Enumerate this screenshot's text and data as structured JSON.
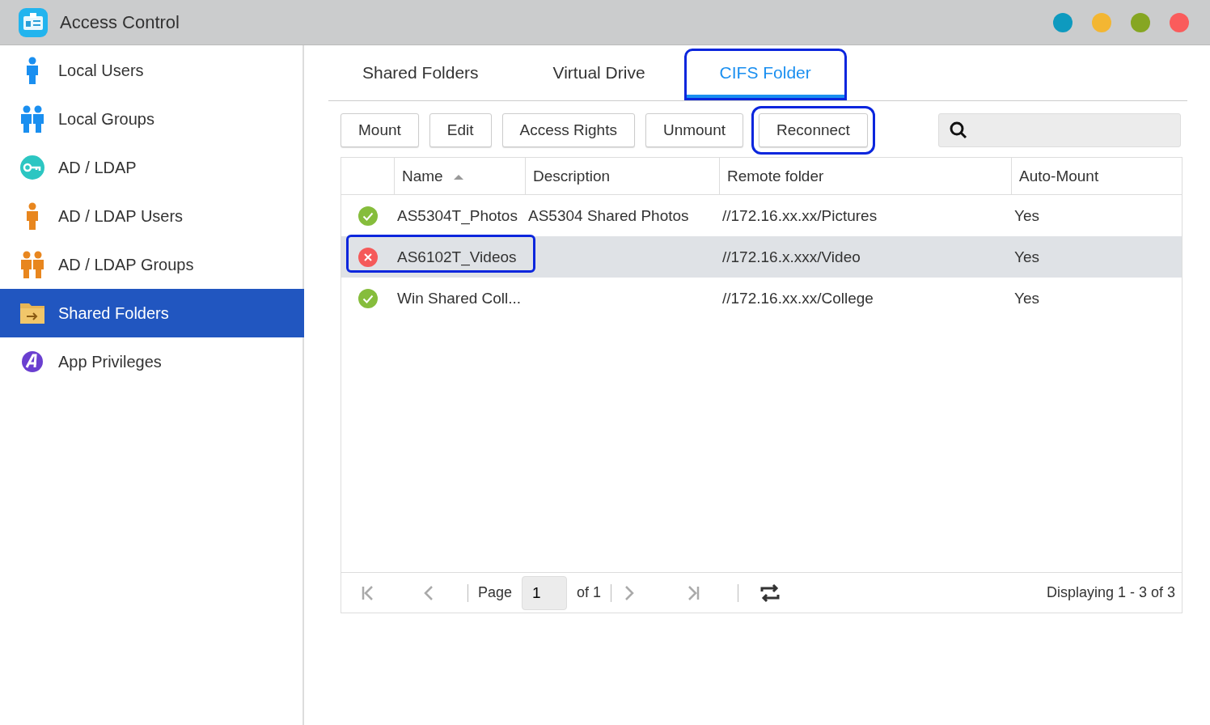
{
  "window": {
    "title": "Access Control",
    "controls": [
      {
        "color": "#0e9abf"
      },
      {
        "color": "#f3b632"
      },
      {
        "color": "#86a622"
      },
      {
        "color": "#fa5c5c"
      }
    ]
  },
  "sidebar": {
    "items": [
      {
        "label": "Local Users",
        "selected": false
      },
      {
        "label": "Local Groups",
        "selected": false
      },
      {
        "label": "AD / LDAP",
        "selected": false
      },
      {
        "label": "AD / LDAP Users",
        "selected": false
      },
      {
        "label": "AD / LDAP Groups",
        "selected": false
      },
      {
        "label": "Shared Folders",
        "selected": true
      },
      {
        "label": "App Privileges",
        "selected": false
      }
    ]
  },
  "tabs": [
    {
      "label": "Shared Folders",
      "selected": false,
      "highlighted": false
    },
    {
      "label": "Virtual Drive",
      "selected": false,
      "highlighted": false
    },
    {
      "label": "CIFS Folder",
      "selected": true,
      "highlighted": true
    }
  ],
  "toolbar": {
    "buttons": [
      {
        "label": "Mount",
        "highlighted": false
      },
      {
        "label": "Edit",
        "highlighted": false
      },
      {
        "label": "Access Rights",
        "highlighted": false
      },
      {
        "label": "Unmount",
        "highlighted": false
      },
      {
        "label": "Reconnect",
        "highlighted": true
      }
    ]
  },
  "table": {
    "columns": [
      {
        "label": "Name",
        "sorted": true
      },
      {
        "label": "Description",
        "sorted": false
      },
      {
        "label": "Remote folder",
        "sorted": false
      },
      {
        "label": "Auto-Mount",
        "sorted": false
      }
    ],
    "rows": [
      {
        "kind": "ok",
        "name": "AS5304T_Photos",
        "description": "AS5304 Shared Photos",
        "remote_folder": "//172.16.xx.xx/Pictures",
        "auto_mount": "Yes",
        "selected": false,
        "highlighted": false
      },
      {
        "kind": "error",
        "name": "AS6102T_Videos",
        "remote_folder": "//172.16.x.xxx/Video",
        "auto_mount": "Yes",
        "selected": true,
        "highlighted": true
      },
      {
        "kind": "ok",
        "name": "Win Shared Coll...",
        "remote_folder": "//172.16.xx.xx/College",
        "auto_mount": "Yes",
        "selected": false,
        "highlighted": false
      }
    ]
  },
  "pager": {
    "page_label": "Page",
    "page": "1",
    "of_pages": "of 1",
    "display": "Displaying 1 - 3 of 3"
  }
}
